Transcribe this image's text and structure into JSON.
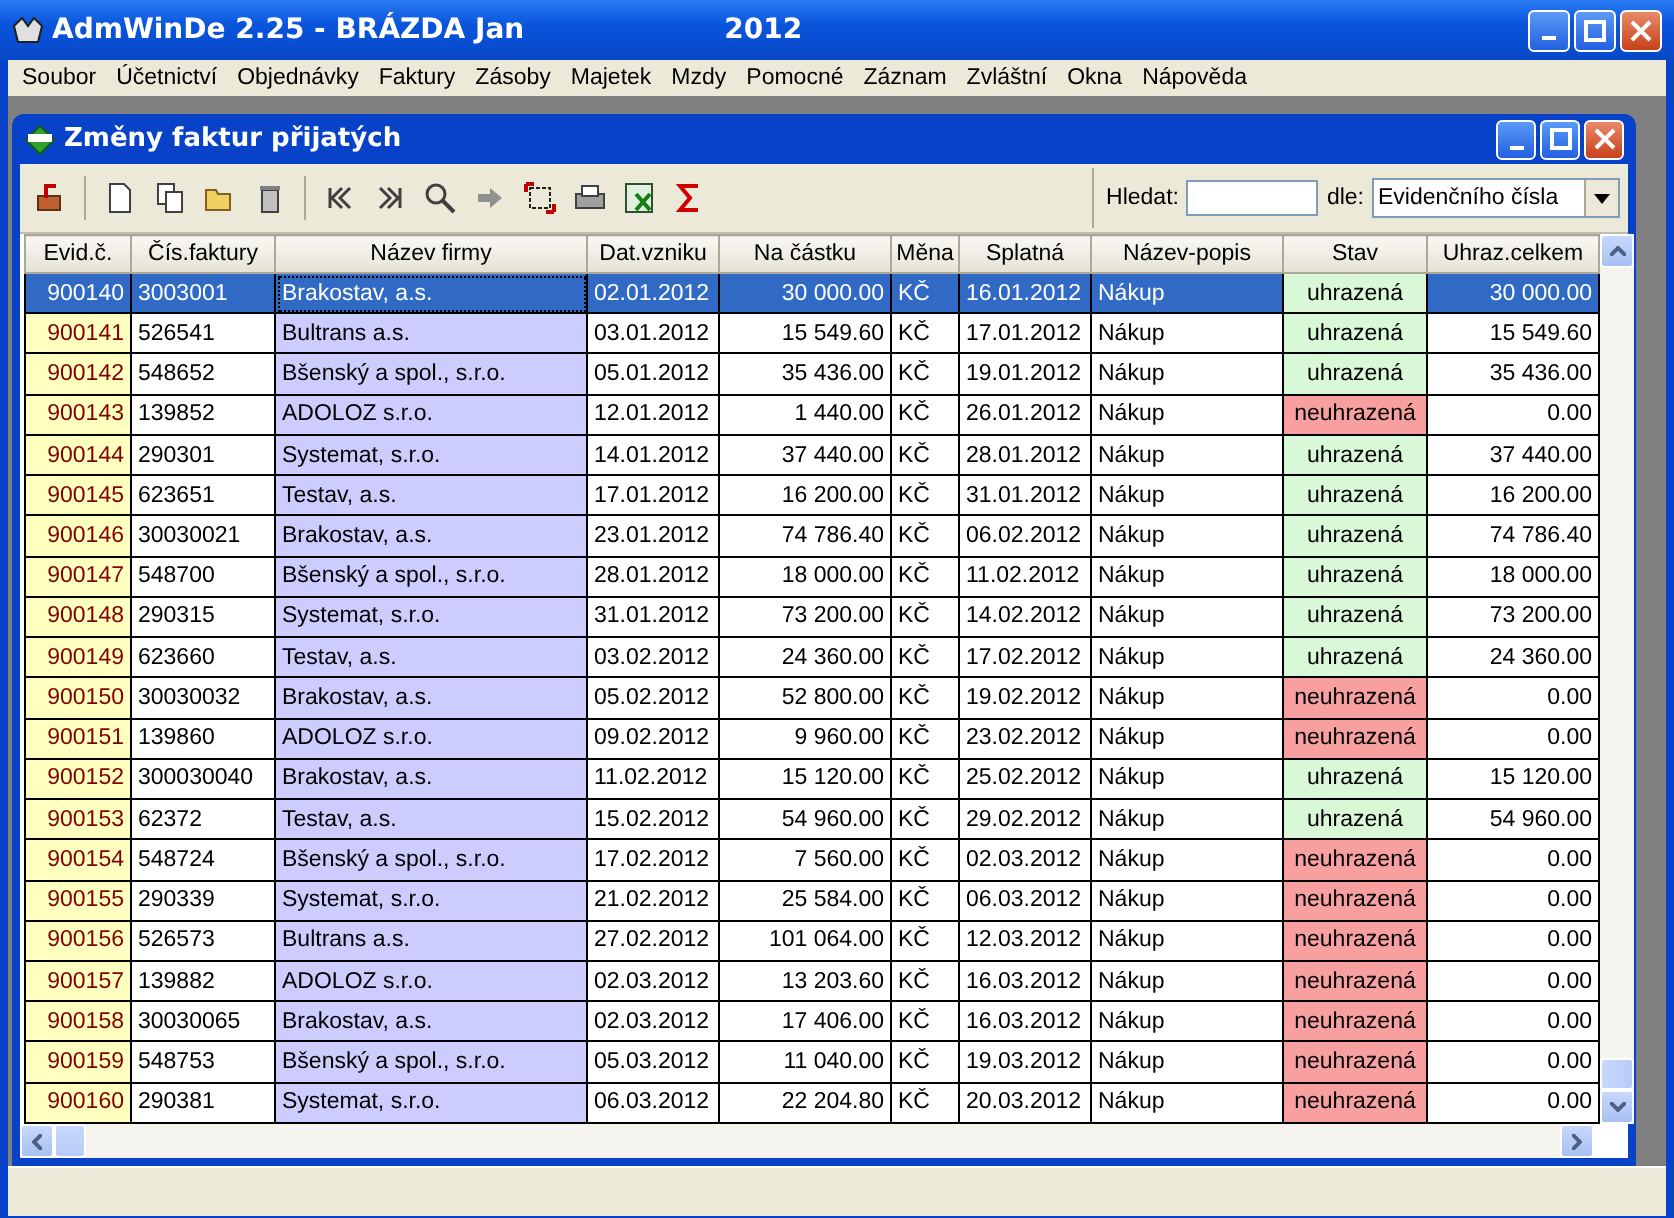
{
  "window": {
    "title": "AdmWinDe 2.25 - BRÁZDA Jan",
    "year": "2012"
  },
  "menu": [
    "Soubor",
    "Účetnictví",
    "Objednávky",
    "Faktury",
    "Zásoby",
    "Majetek",
    "Mzdy",
    "Pomocné",
    "Záznam",
    "Zvláštní",
    "Okna",
    "Nápověda"
  ],
  "child_window": {
    "title": "Změny faktur přijatých"
  },
  "search": {
    "label": "Hledat:",
    "by_label": "dle:",
    "by_value": "Evidenčního čísla"
  },
  "table": {
    "columns": [
      "Evid.č.",
      "Čís.faktury",
      "Název firmy",
      "Dat.vzniku",
      "Na částku",
      "Měna",
      "Splatná",
      "Název-popis",
      "Stav",
      "Uhraz.celkem"
    ],
    "rows": [
      {
        "selected": true,
        "paid": true,
        "cells": [
          "900140",
          "3003001",
          "Brakostav, a.s.",
          "02.01.2012",
          "30 000.00",
          "KČ",
          "16.01.2012",
          "Nákup",
          "uhrazená",
          "30 000.00"
        ]
      },
      {
        "selected": false,
        "paid": true,
        "cells": [
          "900141",
          "526541",
          "Bultrans a.s.",
          "03.01.2012",
          "15 549.60",
          "KČ",
          "17.01.2012",
          "Nákup",
          "uhrazená",
          "15 549.60"
        ]
      },
      {
        "selected": false,
        "paid": true,
        "cells": [
          "900142",
          "548652",
          "Bšenský a spol., s.r.o.",
          "05.01.2012",
          "35 436.00",
          "KČ",
          "19.01.2012",
          "Nákup",
          "uhrazená",
          "35 436.00"
        ]
      },
      {
        "selected": false,
        "paid": false,
        "cells": [
          "900143",
          "139852",
          "ADOLOZ s.r.o.",
          "12.01.2012",
          "1 440.00",
          "KČ",
          "26.01.2012",
          "Nákup",
          "neuhrazená",
          "0.00"
        ]
      },
      {
        "selected": false,
        "paid": true,
        "cells": [
          "900144",
          "290301",
          "Systemat, s.r.o.",
          "14.01.2012",
          "37 440.00",
          "KČ",
          "28.01.2012",
          "Nákup",
          "uhrazená",
          "37 440.00"
        ]
      },
      {
        "selected": false,
        "paid": true,
        "cells": [
          "900145",
          "623651",
          "Testav, a.s.",
          "17.01.2012",
          "16 200.00",
          "KČ",
          "31.01.2012",
          "Nákup",
          "uhrazená",
          "16 200.00"
        ]
      },
      {
        "selected": false,
        "paid": true,
        "cells": [
          "900146",
          "30030021",
          "Brakostav, a.s.",
          "23.01.2012",
          "74 786.40",
          "KČ",
          "06.02.2012",
          "Nákup",
          "uhrazená",
          "74 786.40"
        ]
      },
      {
        "selected": false,
        "paid": true,
        "cells": [
          "900147",
          "548700",
          "Bšenský a spol., s.r.o.",
          "28.01.2012",
          "18 000.00",
          "KČ",
          "11.02.2012",
          "Nákup",
          "uhrazená",
          "18 000.00"
        ]
      },
      {
        "selected": false,
        "paid": true,
        "cells": [
          "900148",
          "290315",
          "Systemat, s.r.o.",
          "31.01.2012",
          "73 200.00",
          "KČ",
          "14.02.2012",
          "Nákup",
          "uhrazená",
          "73 200.00"
        ]
      },
      {
        "selected": false,
        "paid": true,
        "cells": [
          "900149",
          "623660",
          "Testav, a.s.",
          "03.02.2012",
          "24 360.00",
          "KČ",
          "17.02.2012",
          "Nákup",
          "uhrazená",
          "24 360.00"
        ]
      },
      {
        "selected": false,
        "paid": false,
        "cells": [
          "900150",
          "30030032",
          "Brakostav, a.s.",
          "05.02.2012",
          "52 800.00",
          "KČ",
          "19.02.2012",
          "Nákup",
          "neuhrazená",
          "0.00"
        ]
      },
      {
        "selected": false,
        "paid": false,
        "cells": [
          "900151",
          "139860",
          "ADOLOZ s.r.o.",
          "09.02.2012",
          "9 960.00",
          "KČ",
          "23.02.2012",
          "Nákup",
          "neuhrazená",
          "0.00"
        ]
      },
      {
        "selected": false,
        "paid": true,
        "cells": [
          "900152",
          "300030040",
          "Brakostav, a.s.",
          "11.02.2012",
          "15 120.00",
          "KČ",
          "25.02.2012",
          "Nákup",
          "uhrazená",
          "15 120.00"
        ]
      },
      {
        "selected": false,
        "paid": true,
        "cells": [
          "900153",
          "62372",
          "Testav, a.s.",
          "15.02.2012",
          "54 960.00",
          "KČ",
          "29.02.2012",
          "Nákup",
          "uhrazená",
          "54 960.00"
        ]
      },
      {
        "selected": false,
        "paid": false,
        "cells": [
          "900154",
          "548724",
          "Bšenský a spol., s.r.o.",
          "17.02.2012",
          "7 560.00",
          "KČ",
          "02.03.2012",
          "Nákup",
          "neuhrazená",
          "0.00"
        ]
      },
      {
        "selected": false,
        "paid": false,
        "cells": [
          "900155",
          "290339",
          "Systemat, s.r.o.",
          "21.02.2012",
          "25 584.00",
          "KČ",
          "06.03.2012",
          "Nákup",
          "neuhrazená",
          "0.00"
        ]
      },
      {
        "selected": false,
        "paid": false,
        "cells": [
          "900156",
          "526573",
          "Bultrans a.s.",
          "27.02.2012",
          "101 064.00",
          "KČ",
          "12.03.2012",
          "Nákup",
          "neuhrazená",
          "0.00"
        ]
      },
      {
        "selected": false,
        "paid": false,
        "cells": [
          "900157",
          "139882",
          "ADOLOZ s.r.o.",
          "02.03.2012",
          "13 203.60",
          "KČ",
          "16.03.2012",
          "Nákup",
          "neuhrazená",
          "0.00"
        ]
      },
      {
        "selected": false,
        "paid": false,
        "cells": [
          "900158",
          "30030065",
          "Brakostav, a.s.",
          "02.03.2012",
          "17 406.00",
          "KČ",
          "16.03.2012",
          "Nákup",
          "neuhrazená",
          "0.00"
        ]
      },
      {
        "selected": false,
        "paid": false,
        "cells": [
          "900159",
          "548753",
          "Bšenský a spol., s.r.o.",
          "05.03.2012",
          "11 040.00",
          "KČ",
          "19.03.2012",
          "Nákup",
          "neuhrazená",
          "0.00"
        ]
      },
      {
        "selected": false,
        "paid": false,
        "cells": [
          "900160",
          "290381",
          "Systemat, s.r.o.",
          "06.03.2012",
          "22 204.80",
          "KČ",
          "20.03.2012",
          "Nákup",
          "neuhrazená",
          "0.00"
        ]
      }
    ]
  }
}
